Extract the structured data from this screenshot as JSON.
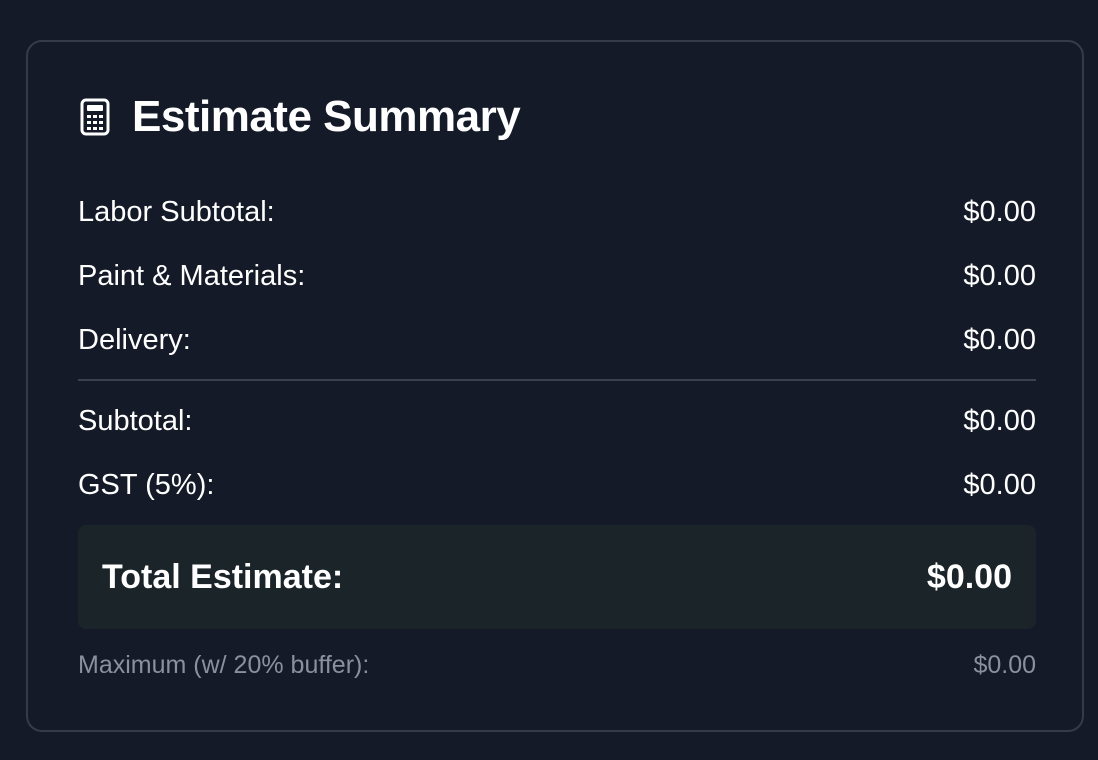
{
  "header": {
    "title": "Estimate Summary",
    "icon": "calculator-icon"
  },
  "rows": [
    {
      "label": "Labor Subtotal:",
      "value": "$0.00"
    },
    {
      "label": "Paint & Materials:",
      "value": "$0.00"
    },
    {
      "label": "Delivery:",
      "value": "$0.00"
    },
    {
      "label": "Subtotal:",
      "value": "$0.00"
    },
    {
      "label": "GST (5%):",
      "value": "$0.00"
    }
  ],
  "total": {
    "label": "Total Estimate:",
    "value": "$0.00"
  },
  "maximum": {
    "label": "Maximum (w/ 20% buffer):",
    "value": "$0.00"
  },
  "colors": {
    "background": "#141a27",
    "border": "#343b4a",
    "total_box": "#1b2428",
    "muted_text": "#8a909c",
    "text": "#ffffff"
  }
}
